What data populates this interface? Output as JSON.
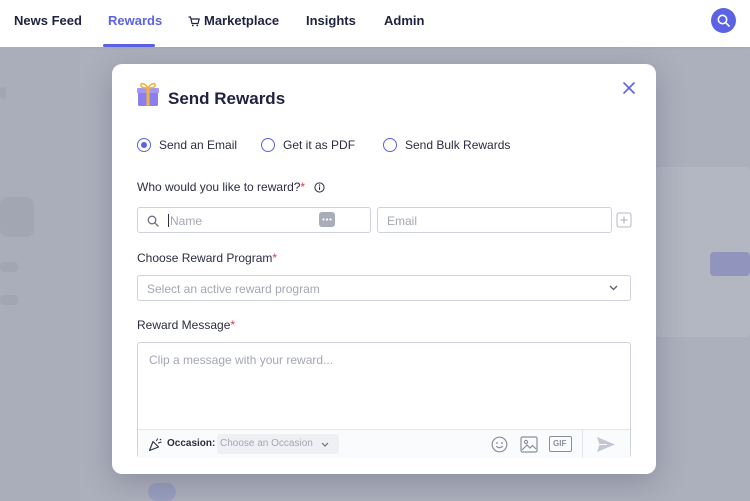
{
  "nav": {
    "items": [
      {
        "label": "News Feed"
      },
      {
        "label": "Rewards"
      },
      {
        "label": "Marketplace"
      },
      {
        "label": "Insights"
      },
      {
        "label": "Admin"
      }
    ],
    "active": "Rewards"
  },
  "modal": {
    "title": "Send Rewards",
    "delivery_options": [
      {
        "label": "Send an Email",
        "checked": true
      },
      {
        "label": "Get it as PDF",
        "checked": false
      },
      {
        "label": "Send Bulk Rewards",
        "checked": false
      }
    ],
    "recipient": {
      "label": "Who would you like to reward?",
      "required_mark": "*",
      "name_placeholder": "Name",
      "email_placeholder": "Email"
    },
    "program": {
      "label": "Choose Reward Program",
      "required_mark": "*",
      "placeholder": "Select an active reward program"
    },
    "message": {
      "label": "Reward Message",
      "required_mark": "*",
      "placeholder": "Clip a message with your reward...",
      "occasion_label": "Occasion:",
      "occasion_placeholder": "Choose an Occasion",
      "gif_label": "GIF"
    }
  },
  "colors": {
    "accent": "#5b62e3",
    "required": "#e0394e",
    "gift_box": "#8b7ff0",
    "gift_ribbon": "#f2b33d"
  }
}
